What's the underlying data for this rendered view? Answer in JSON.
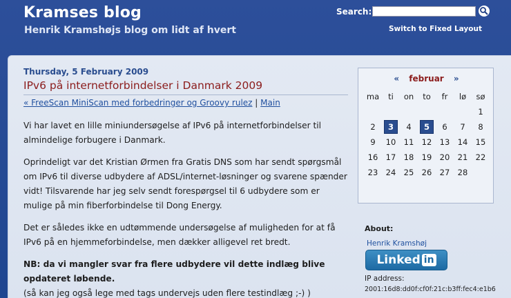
{
  "header": {
    "title": "Kramses blog",
    "subtitle": "Henrik Kramshøjs blog om lidt af hvert",
    "search_label": "Search:",
    "search_value": "",
    "fixed_layout_link": "Switch to Fixed Layout"
  },
  "post": {
    "date": "Thursday, 5 February 2009",
    "title": "IPv6 på internetforbindelser i Danmark 2009",
    "prev_link": "« FreeScan MiniScan med forbedringer og Groovy rulez",
    "nav_separator": "|",
    "main_link": "Main",
    "paragraphs": [
      "Vi har lavet en lille miniundersøgelse af IPv6 på internetforbindelser til almindelige forbugere i Danmark.",
      "Oprindeligt var det Kristian Ørmen fra Gratis DNS som har sendt spørgsmål om IPv6 til diverse udbydere af ADSL/internet-løsninger og svarene spænder vidt! Tilsvarende har jeg selv sendt forespørgsel til 6 udbydere som er mulige på min fiberforbindelse til Dong Energy.",
      "Det er således ikke en udtømmende undersøgelse af muligheden for at få IPv6 på en hjemmeforbindelse, men dækker alligevel ret bredt."
    ],
    "bold_note": "NB: da vi mangler svar fra flere udbydere vil dette indlæg blive opdateret løbende.",
    "last_line": "(så kan jeg også lege med tags undervejs uden flere testindlæg ;-) )"
  },
  "calendar": {
    "prev": "«",
    "month": "februar",
    "next": "»",
    "day_names": [
      "ma",
      "ti",
      "on",
      "to",
      "fr",
      "lø",
      "sø"
    ],
    "weeks": [
      [
        "",
        "",
        "",
        "",
        "",
        "",
        "1"
      ],
      [
        "2",
        "3",
        "4",
        "5",
        "6",
        "7",
        "8"
      ],
      [
        "9",
        "10",
        "11",
        "12",
        "13",
        "14",
        "15"
      ],
      [
        "16",
        "17",
        "18",
        "19",
        "20",
        "21",
        "22"
      ],
      [
        "23",
        "24",
        "25",
        "26",
        "27",
        "28",
        ""
      ]
    ],
    "highlighted": [
      "3",
      "5"
    ]
  },
  "sidebar": {
    "about_label": "About:",
    "author_link": "Henrik Kramshøj",
    "linkedin_text": "Linked",
    "linkedin_in": "in",
    "ip_label": "IP address:",
    "ip_value": "2001:16d8:dd0f:cf0f:21c:b3ff:fec4:e1b6"
  },
  "colors": {
    "header_bg": "#2d4f9a",
    "content_bg": "#e3e9f3",
    "title_red": "#8b1c1c",
    "link_blue": "#1f4f9e",
    "highlight_blue": "#2a4d8f",
    "linkedin_blue": "#1d6aa3"
  }
}
